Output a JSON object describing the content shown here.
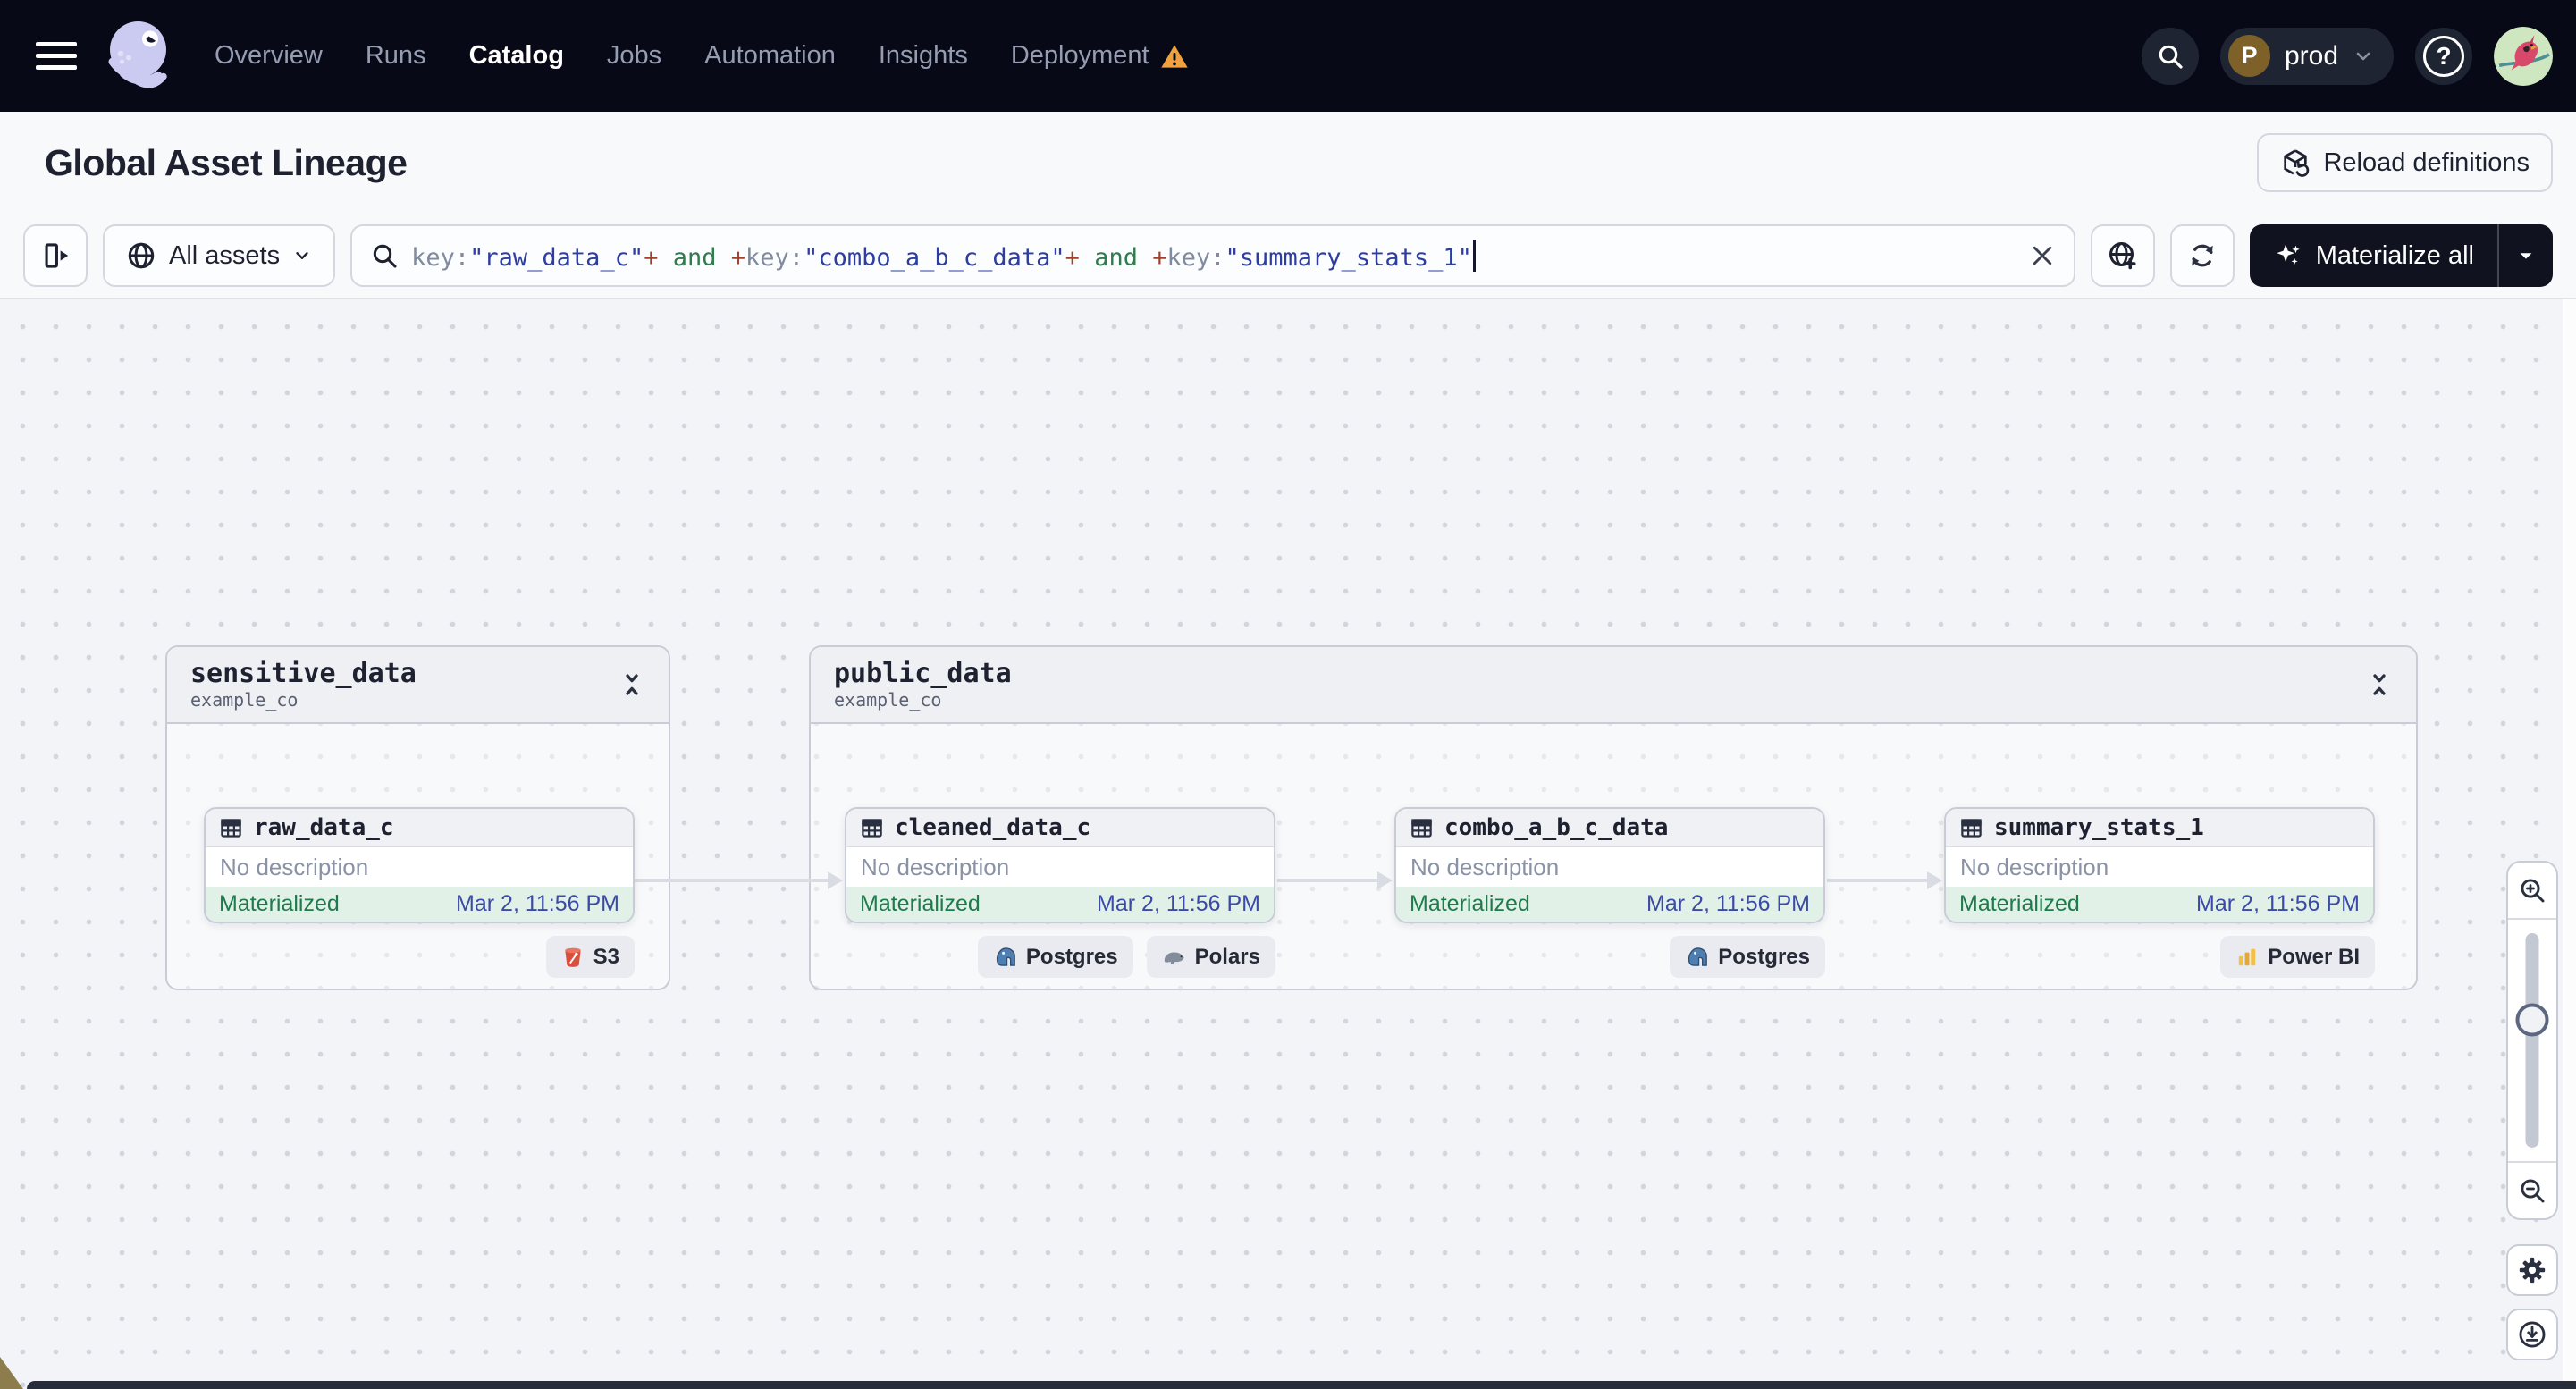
{
  "nav": {
    "items": [
      {
        "label": "Overview",
        "active": false
      },
      {
        "label": "Runs",
        "active": false
      },
      {
        "label": "Catalog",
        "active": true
      },
      {
        "label": "Jobs",
        "active": false
      },
      {
        "label": "Automation",
        "active": false
      },
      {
        "label": "Insights",
        "active": false
      },
      {
        "label": "Deployment",
        "active": false,
        "warning": true
      }
    ],
    "environment": {
      "initial": "P",
      "label": "prod"
    }
  },
  "header": {
    "title": "Global Asset Lineage",
    "reload_label": "Reload definitions"
  },
  "toolbar": {
    "scope_label": "All assets",
    "materialize_label": "Materialize all",
    "query_segments": [
      {
        "text": "key:",
        "color": "#808b9f"
      },
      {
        "text": "\"raw_data_c\"",
        "color": "#2d3da0"
      },
      {
        "text": "+",
        "color": "#a0402c"
      },
      {
        "text": " and ",
        "color": "#2f7d4e"
      },
      {
        "text": "+",
        "color": "#a0402c"
      },
      {
        "text": "key:",
        "color": "#808b9f"
      },
      {
        "text": "\"combo_a_b_c_data\"",
        "color": "#2d3da0"
      },
      {
        "text": "+",
        "color": "#a0402c"
      },
      {
        "text": " and ",
        "color": "#2f7d4e"
      },
      {
        "text": "+",
        "color": "#a0402c"
      },
      {
        "text": "key:",
        "color": "#808b9f"
      },
      {
        "text": "\"summary_stats_1\"",
        "color": "#2d3da0"
      }
    ]
  },
  "graph": {
    "groups": [
      {
        "name": "sensitive_data",
        "location": "example_co",
        "nodes": [
          {
            "name": "raw_data_c",
            "description": "No description",
            "status": "Materialized",
            "timestamp": "Mar 2, 11:56 PM",
            "badges": [
              {
                "label": "S3",
                "icon": "s3-icon"
              }
            ]
          }
        ]
      },
      {
        "name": "public_data",
        "location": "example_co",
        "nodes": [
          {
            "name": "cleaned_data_c",
            "description": "No description",
            "status": "Materialized",
            "timestamp": "Mar 2, 11:56 PM",
            "badges": [
              {
                "label": "Postgres",
                "icon": "postgres-icon"
              },
              {
                "label": "Polars",
                "icon": "polars-icon"
              }
            ]
          },
          {
            "name": "combo_a_b_c_data",
            "description": "No description",
            "status": "Materialized",
            "timestamp": "Mar 2, 11:56 PM",
            "badges": [
              {
                "label": "Postgres",
                "icon": "postgres-icon"
              }
            ]
          },
          {
            "name": "summary_stats_1",
            "description": "No description",
            "status": "Materialized",
            "timestamp": "Mar 2, 11:56 PM",
            "badges": [
              {
                "label": "Power BI",
                "icon": "powerbi-icon"
              }
            ]
          }
        ]
      }
    ]
  },
  "colors": {
    "status_green": "#1f7a4c",
    "timestamp_blue": "#3b4aa5",
    "warning_orange": "#f0a03c",
    "nav_bg": "#070a16",
    "accent_dark": "#10131f"
  }
}
